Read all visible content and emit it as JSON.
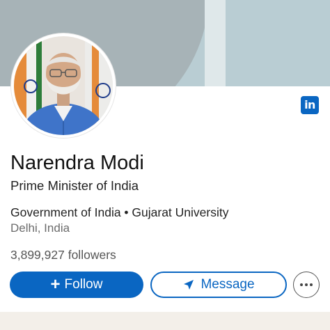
{
  "profile": {
    "name": "Narendra Modi",
    "headline": "Prime Minister of India",
    "organizations": "Government of India • Gujarat University",
    "location": "Delhi, India",
    "followers": "3,899,927 followers"
  },
  "actions": {
    "follow_label": "Follow",
    "follow_icon": "plus-icon",
    "message_label": "Message",
    "message_icon": "send-icon",
    "more_icon": "ellipsis-icon"
  },
  "brand": {
    "logo_text": "in",
    "logo_icon": "linkedin-logo-icon"
  },
  "colors": {
    "accent": "#0a66c2",
    "banner": "#b9cdd3",
    "banner_dark": "#a7b3b7"
  }
}
